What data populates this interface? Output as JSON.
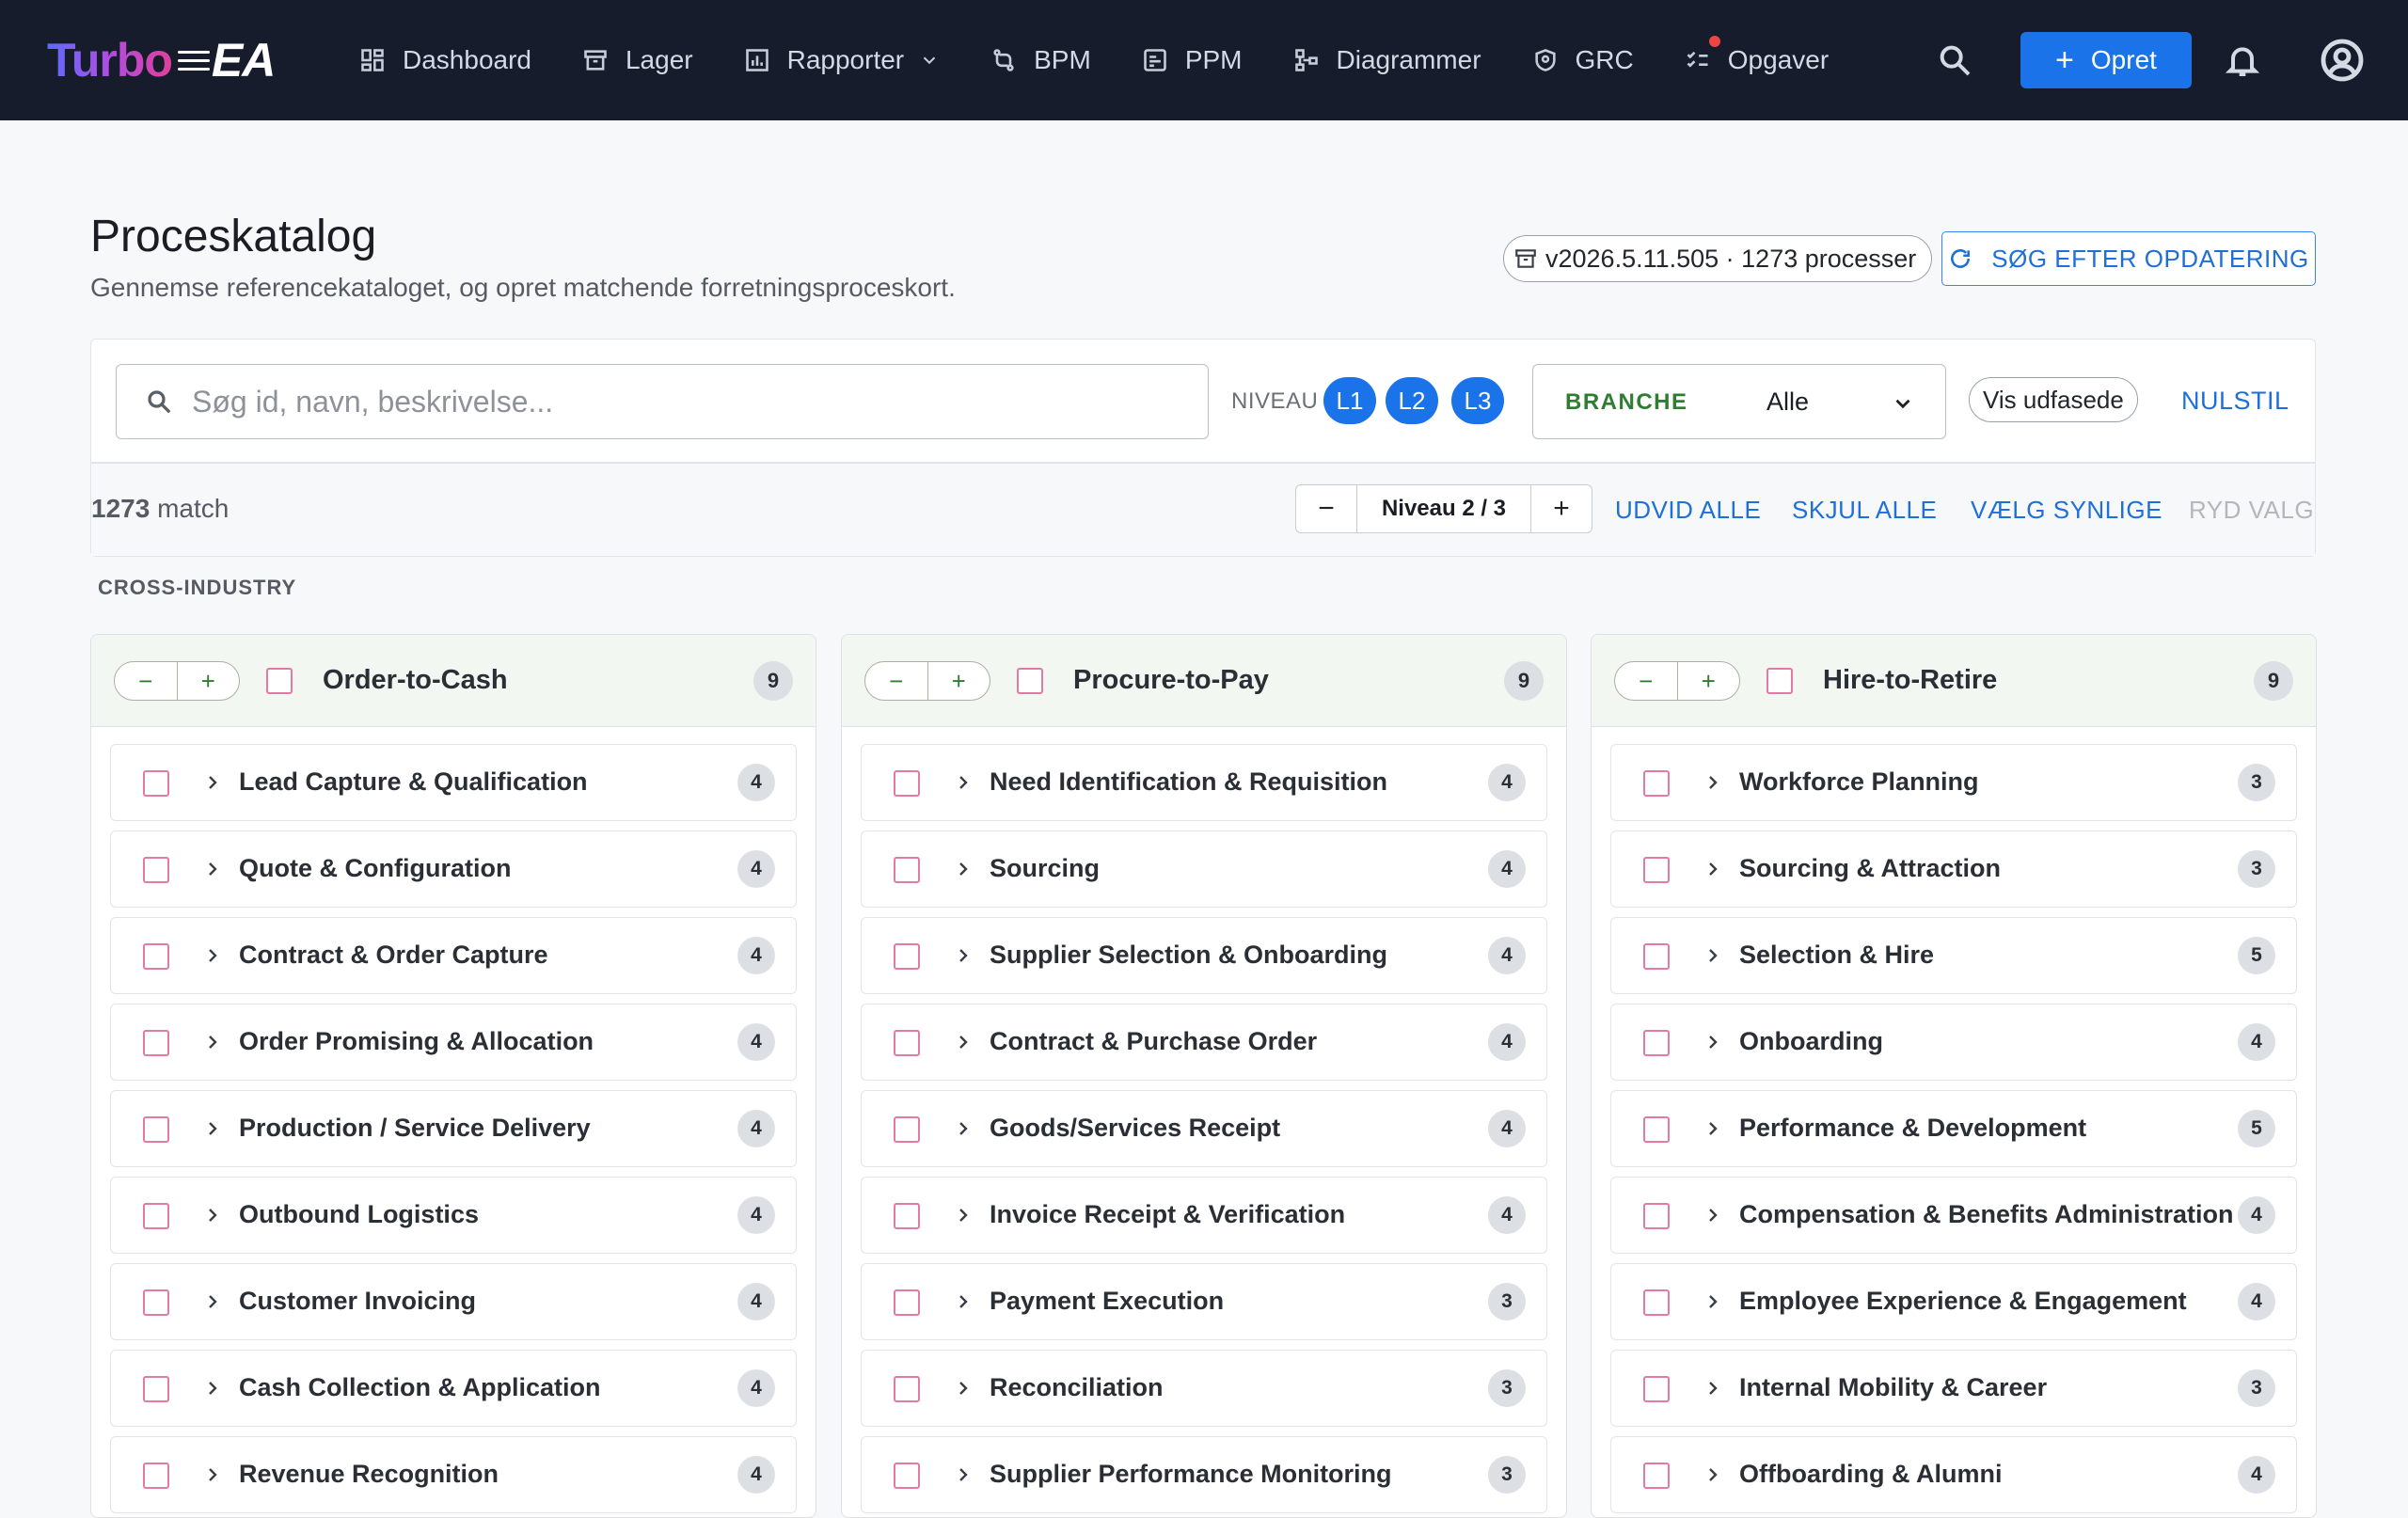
{
  "app": {
    "logo_primary": "Turbo",
    "logo_secondary": "EA"
  },
  "nav": {
    "items": [
      {
        "label": "Dashboard",
        "icon": "dashboard-icon"
      },
      {
        "label": "Lager",
        "icon": "archive-icon"
      },
      {
        "label": "Rapporter",
        "icon": "report-icon"
      },
      {
        "label": "BPM",
        "icon": "bpm-icon"
      },
      {
        "label": "PPM",
        "icon": "ppm-icon"
      },
      {
        "label": "Diagrammer",
        "icon": "diagram-icon"
      },
      {
        "label": "GRC",
        "icon": "shield-icon"
      },
      {
        "label": "Opgaver",
        "icon": "tasks-icon"
      }
    ],
    "create_label": "Opret"
  },
  "header": {
    "title": "Proceskatalog",
    "subtitle": "Gennemse referencekataloget, og opret matchende forretningsproceskort.",
    "version": "v2026.5.11.505 · 1273 processer",
    "update_label": "SØG EFTER OPDATERING"
  },
  "filters": {
    "search_placeholder": "Søg id, navn, beskrivelse...",
    "niveau_label": "NIVEAU",
    "levels": [
      "L1",
      "L2",
      "L3"
    ],
    "branche_label": "BRANCHE",
    "branche_value": "Alle",
    "vis_udfasede": "Vis udfasede",
    "reset_label": "NULSTIL"
  },
  "toolbar": {
    "match_count": "1273",
    "match_label": "match",
    "level_display": "Niveau 2 / 3",
    "minus": "−",
    "plus": "+",
    "expand_all": "UDVID ALLE",
    "collapse_all": "SKJUL ALLE",
    "select_visible": "VÆLG SYNLIGE",
    "clear_selection": "RYD VALG"
  },
  "section": {
    "label": "CROSS-INDUSTRY"
  },
  "columns": [
    {
      "title": "Order-to-Cash",
      "count": "9",
      "rows": [
        {
          "name": "Lead Capture & Qualification",
          "count": "4"
        },
        {
          "name": "Quote & Configuration",
          "count": "4"
        },
        {
          "name": "Contract & Order Capture",
          "count": "4"
        },
        {
          "name": "Order Promising & Allocation",
          "count": "4"
        },
        {
          "name": "Production / Service Delivery",
          "count": "4"
        },
        {
          "name": "Outbound Logistics",
          "count": "4"
        },
        {
          "name": "Customer Invoicing",
          "count": "4"
        },
        {
          "name": "Cash Collection & Application",
          "count": "4"
        },
        {
          "name": "Revenue Recognition",
          "count": "4"
        }
      ]
    },
    {
      "title": "Procure-to-Pay",
      "count": "9",
      "rows": [
        {
          "name": "Need Identification & Requisition",
          "count": "4"
        },
        {
          "name": "Sourcing",
          "count": "4"
        },
        {
          "name": "Supplier Selection & Onboarding",
          "count": "4"
        },
        {
          "name": "Contract & Purchase Order",
          "count": "4"
        },
        {
          "name": "Goods/Services Receipt",
          "count": "4"
        },
        {
          "name": "Invoice Receipt & Verification",
          "count": "4"
        },
        {
          "name": "Payment Execution",
          "count": "3"
        },
        {
          "name": "Reconciliation",
          "count": "3"
        },
        {
          "name": "Supplier Performance Monitoring",
          "count": "3"
        }
      ]
    },
    {
      "title": "Hire-to-Retire",
      "count": "9",
      "rows": [
        {
          "name": "Workforce Planning",
          "count": "3"
        },
        {
          "name": "Sourcing & Attraction",
          "count": "3"
        },
        {
          "name": "Selection & Hire",
          "count": "5"
        },
        {
          "name": "Onboarding",
          "count": "4"
        },
        {
          "name": "Performance & Development",
          "count": "5"
        },
        {
          "name": "Compensation & Benefits Administration",
          "count": "4"
        },
        {
          "name": "Employee Experience & Engagement",
          "count": "4"
        },
        {
          "name": "Internal Mobility & Career",
          "count": "3"
        },
        {
          "name": "Offboarding & Alumni",
          "count": "4"
        }
      ]
    }
  ],
  "colors": {
    "nav_bg": "#161c2c",
    "accent": "#1a73e8",
    "branche_label": "#2e7d32",
    "checkbox_border": "#e27aa4",
    "notification_dot": "#ef4444"
  }
}
